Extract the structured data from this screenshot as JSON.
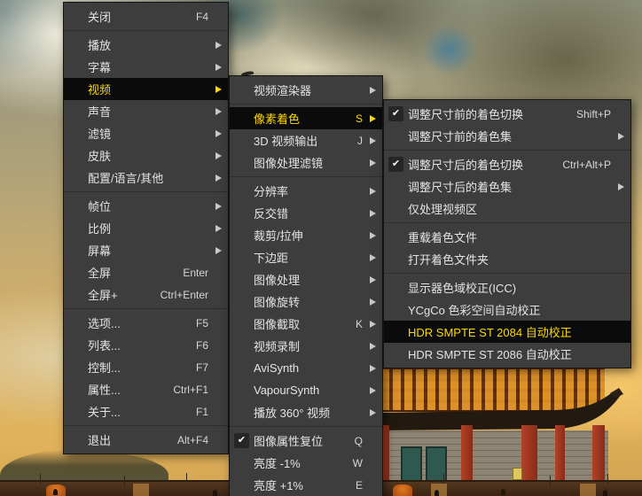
{
  "scene": {
    "description": "golden cloudy sky over a Chinese temple gate (paused video frame)",
    "colors": {
      "sky_teal": "#3a5a60",
      "sky_gold": "#d9a94e",
      "cloud_cream": "#eee4c6",
      "temple_red": "#9c3522",
      "roof_dark": "#221a10",
      "menu_bg": "#3d3d3d",
      "menu_highlight_bg": "#0b0b0b",
      "menu_highlight_text": "#ffd800",
      "menu_text": "#e4e4e4"
    }
  },
  "icons": {
    "checkmark": "✔",
    "submenu_arrow": "▶"
  },
  "menus": {
    "main": {
      "name": "player-context-menu",
      "items": [
        {
          "id": "close",
          "label": "关闭",
          "shortcut": "F4"
        },
        {
          "separator": true
        },
        {
          "id": "play",
          "label": "播放",
          "submenu": true
        },
        {
          "id": "subtitles",
          "label": "字幕",
          "submenu": true
        },
        {
          "id": "video",
          "label": "视频",
          "submenu": true,
          "highlighted": true
        },
        {
          "id": "audio",
          "label": "声音",
          "submenu": true
        },
        {
          "id": "filters",
          "label": "滤镜",
          "submenu": true
        },
        {
          "id": "skins",
          "label": "皮肤",
          "submenu": true
        },
        {
          "id": "config-language-other",
          "label": "配置/语言/其他",
          "submenu": true
        },
        {
          "separator": true
        },
        {
          "id": "frame-step",
          "label": "帧位",
          "submenu": true
        },
        {
          "id": "aspect-ratio",
          "label": "比例",
          "submenu": true
        },
        {
          "id": "screen",
          "label": "屏幕",
          "submenu": true
        },
        {
          "id": "fullscreen",
          "label": "全屏",
          "shortcut": "Enter"
        },
        {
          "id": "fullscreen-plus",
          "label": "全屏+",
          "shortcut": "Ctrl+Enter"
        },
        {
          "separator": true
        },
        {
          "id": "options",
          "label": "选项...",
          "shortcut": "F5"
        },
        {
          "id": "playlist",
          "label": "列表...",
          "shortcut": "F6"
        },
        {
          "id": "control",
          "label": "控制...",
          "shortcut": "F7"
        },
        {
          "id": "properties",
          "label": "属性...",
          "shortcut": "Ctrl+F1"
        },
        {
          "id": "about",
          "label": "关于...",
          "shortcut": "F1"
        },
        {
          "separator": true
        },
        {
          "id": "exit",
          "label": "退出",
          "shortcut": "Alt+F4"
        }
      ]
    },
    "video": {
      "name": "video-submenu",
      "items": [
        {
          "id": "video-renderer",
          "label": "视频渲染器",
          "submenu": true
        },
        {
          "separator": true
        },
        {
          "id": "pixel-shaders",
          "label": "像素着色",
          "shortcut": "S",
          "submenu": true,
          "highlighted": true
        },
        {
          "id": "3d-video-output",
          "label": "3D 视频输出",
          "shortcut": "J",
          "submenu": true
        },
        {
          "id": "image-processing-filters",
          "label": "图像处理滤镜",
          "submenu": true
        },
        {
          "separator": true
        },
        {
          "id": "resolution",
          "label": "分辨率",
          "submenu": true
        },
        {
          "id": "deinterlace",
          "label": "反交错",
          "submenu": true
        },
        {
          "id": "crop-stretch",
          "label": "裁剪/拉伸",
          "submenu": true
        },
        {
          "id": "bottom-margin",
          "label": "下边距",
          "submenu": true
        },
        {
          "id": "image-processing",
          "label": "图像处理",
          "submenu": true
        },
        {
          "id": "image-rotation",
          "label": "图像旋转",
          "submenu": true
        },
        {
          "id": "image-capture",
          "label": "图像截取",
          "shortcut": "K",
          "submenu": true
        },
        {
          "id": "video-recording",
          "label": "视频录制",
          "submenu": true
        },
        {
          "id": "avisynth",
          "label": "AviSynth",
          "submenu": true
        },
        {
          "id": "vapoursynth",
          "label": "VapourSynth",
          "submenu": true
        },
        {
          "id": "play-360-video",
          "label": "播放 360° 视频",
          "submenu": true
        },
        {
          "separator": true
        },
        {
          "id": "reset-image-properties",
          "label": "图像属性复位",
          "shortcut": "Q",
          "checked": true
        },
        {
          "id": "brightness-minus-1",
          "label": "亮度 -1%",
          "shortcut": "W"
        },
        {
          "id": "brightness-plus-1",
          "label": "亮度 +1%",
          "shortcut": "E"
        }
      ]
    },
    "shader": {
      "name": "pixel-shader-submenu",
      "items": [
        {
          "id": "pre-resize-shader-toggle",
          "label": "调整尺寸前的着色切换",
          "shortcut": "Shift+P",
          "checked": true
        },
        {
          "id": "pre-resize-shader-set",
          "label": "调整尺寸前的着色集",
          "submenu": true
        },
        {
          "separator": true
        },
        {
          "id": "post-resize-shader-toggle",
          "label": "调整尺寸后的着色切换",
          "shortcut": "Ctrl+Alt+P",
          "checked": true
        },
        {
          "id": "post-resize-shader-set",
          "label": "调整尺寸后的着色集",
          "submenu": true
        },
        {
          "id": "process-video-area-only",
          "label": "仅处理视频区"
        },
        {
          "separator": true
        },
        {
          "id": "reload-shader-files",
          "label": "重载着色文件"
        },
        {
          "id": "open-shader-folder",
          "label": "打开着色文件夹"
        },
        {
          "separator": true
        },
        {
          "id": "display-gamut-correction-icc",
          "label": "显示器色域校正(ICC)"
        },
        {
          "id": "ycgco-colorspace-auto-correction",
          "label": "YCgCo 色彩空间自动校正"
        },
        {
          "id": "hdr-smpte-st-2084-auto-correction",
          "label": "HDR SMPTE ST 2084 自动校正",
          "highlighted": true
        },
        {
          "id": "hdr-smpte-st-2086-auto-correction",
          "label": "HDR SMPTE ST 2086 自动校正"
        }
      ]
    }
  }
}
